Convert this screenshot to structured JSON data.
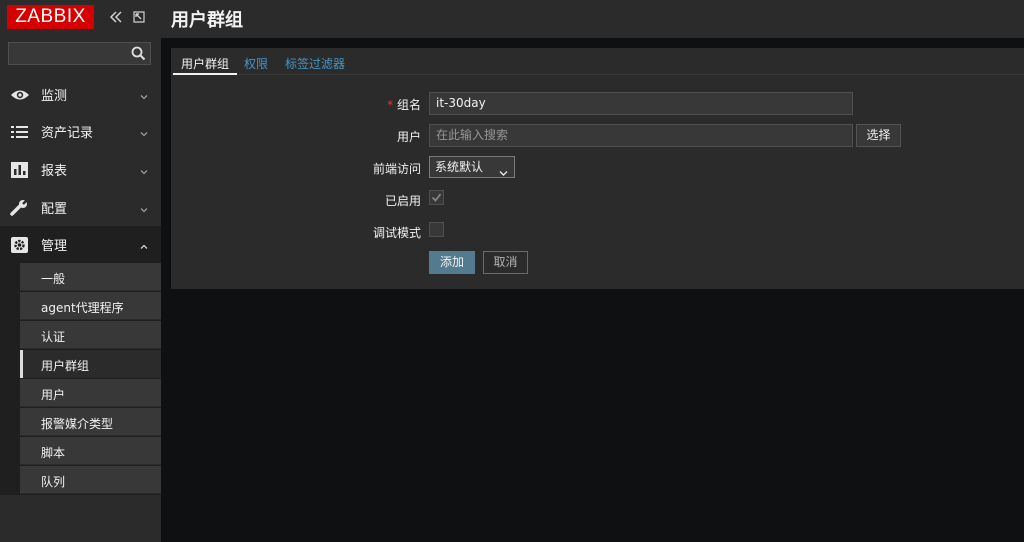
{
  "app": {
    "logo_text": "ZABBIX",
    "brand_color": "#d40000"
  },
  "header": {
    "title": "用户群组"
  },
  "sidebar": {
    "search": {
      "value": "",
      "placeholder": ""
    },
    "menu": [
      {
        "label": "监测",
        "icon": "eye-icon"
      },
      {
        "label": "资产记录",
        "icon": "list-icon"
      },
      {
        "label": "报表",
        "icon": "bar-chart-icon"
      },
      {
        "label": "配置",
        "icon": "wrench-icon"
      },
      {
        "label": "管理",
        "icon": "gear-icon"
      }
    ],
    "submenu": [
      {
        "label": "一般"
      },
      {
        "label": "agent代理程序"
      },
      {
        "label": "认证"
      },
      {
        "label": "用户群组"
      },
      {
        "label": "用户"
      },
      {
        "label": "报警媒介类型"
      },
      {
        "label": "脚本"
      },
      {
        "label": "队列"
      }
    ]
  },
  "tabs": [
    {
      "label": "用户群组"
    },
    {
      "label": "权限"
    },
    {
      "label": "标签过滤器"
    }
  ],
  "form": {
    "group_name": {
      "label": "组名",
      "value": "it-30day"
    },
    "users": {
      "label": "用户",
      "placeholder": "在此输入搜索",
      "select_label": "选择"
    },
    "frontend_access": {
      "label": "前端访问",
      "value": "系统默认"
    },
    "enabled": {
      "label": "已启用",
      "checked": true
    },
    "debug_mode": {
      "label": "调试模式",
      "checked": false
    },
    "add_label": "添加",
    "cancel_label": "取消"
  }
}
